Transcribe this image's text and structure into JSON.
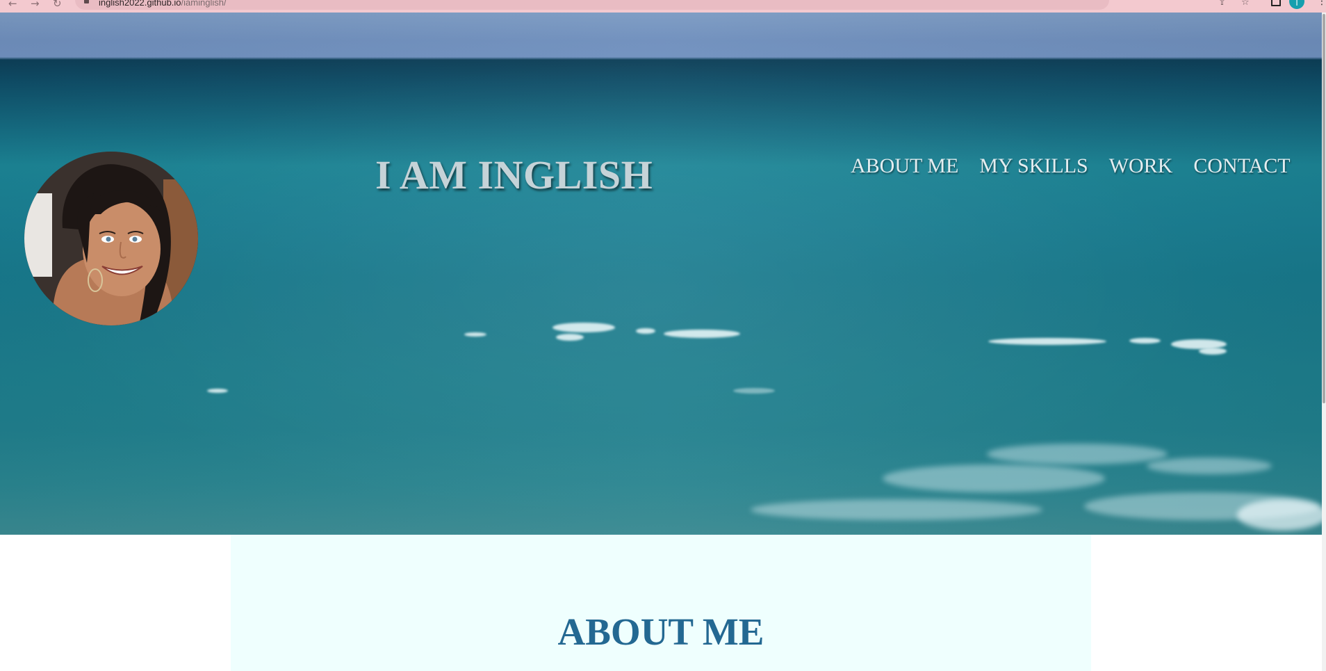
{
  "browser": {
    "url_host": "inglish2022.github.io",
    "url_path": "/iaminglish/",
    "profile_initial": "I"
  },
  "header": {
    "title": "I AM INGLISH",
    "nav": [
      {
        "label": "ABOUT ME"
      },
      {
        "label": "MY SKILLS"
      },
      {
        "label": "WORK"
      },
      {
        "label": "CONTACT"
      }
    ]
  },
  "about": {
    "heading": "ABOUT ME"
  },
  "colors": {
    "title_text": "#c5d3d8",
    "nav_text": "#e3edf0",
    "about_heading": "#236892",
    "about_bg": "#effffe",
    "browser_bar": "#f3c9cf",
    "profile_badge": "#159fae"
  },
  "icons": {
    "back": "arrow-left-icon",
    "forward": "arrow-right-icon",
    "reload": "reload-icon",
    "lock": "lock-icon",
    "share": "share-icon",
    "bookmark": "star-icon",
    "extensions": "puzzle-icon",
    "menu": "kebab-menu-icon"
  }
}
